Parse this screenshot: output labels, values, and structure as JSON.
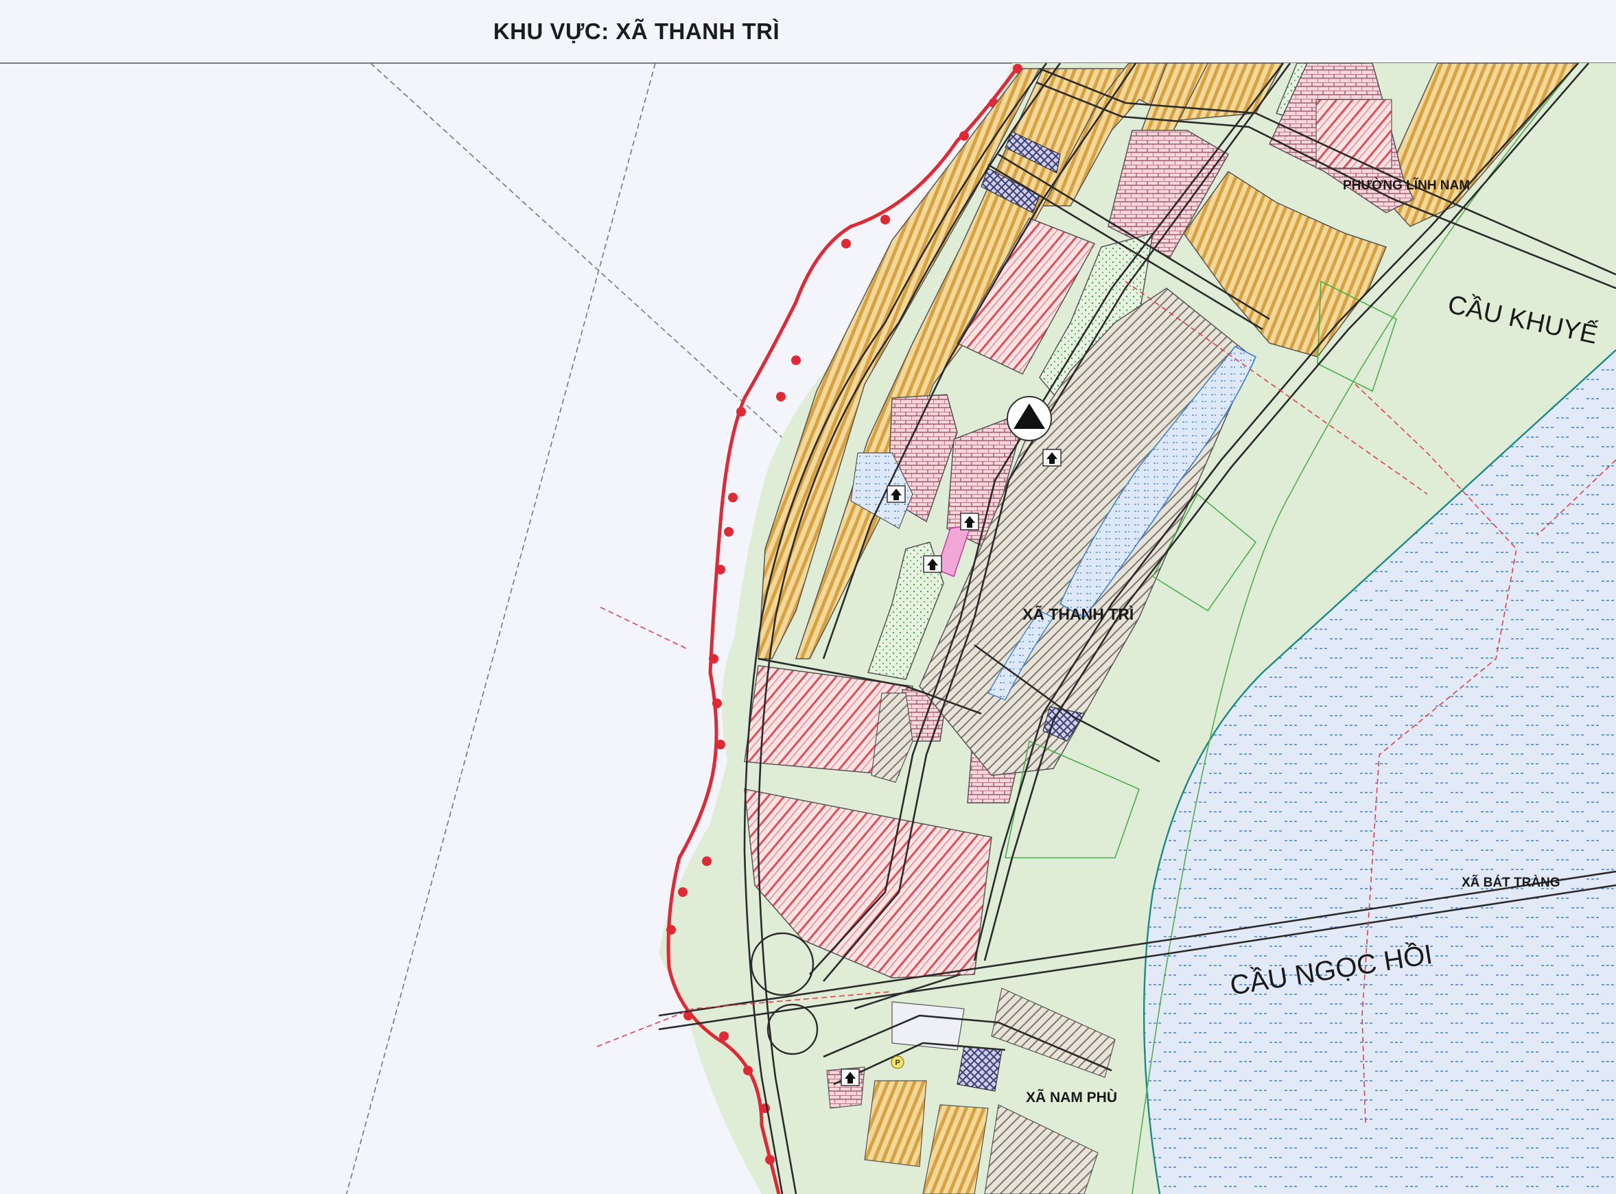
{
  "header": {
    "title": "KHU VỰC: XÃ THANH TRÌ"
  },
  "map": {
    "labels": {
      "thanh_tri": "XÃ THANH TRÌ",
      "linh_nam": "PHƯỜNG LĨNH NAM",
      "cau_khuyen": "CẦU KHUYẾ",
      "bat_trang": "XÃ BÁT TRÀNG",
      "cau_ngoc_hoi": "CẦU NGỌC HỒI",
      "nam_phu": "XÃ NAM PHÙ"
    },
    "icons": [
      "triangle-landmark-icon",
      "house-icon",
      "parking-icon"
    ],
    "colors": {
      "paper": "#f3f5fb",
      "residential_orange": "#e3b45d",
      "public_red": "#ea6a72",
      "green_land": "#dfedd7",
      "river_water": "#dbe6f4",
      "water_dash": "#3e7fd1",
      "boundary_red": "#e02935",
      "industrial_navy": "#4a4d80",
      "mixed_pink": "#d9a1aa",
      "road": "#2b2b2b"
    }
  }
}
